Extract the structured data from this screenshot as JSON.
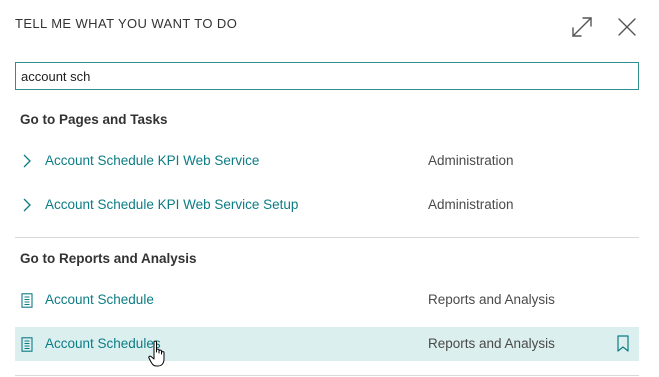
{
  "dialog": {
    "title": "TELL ME WHAT YOU WANT TO DO",
    "expand_icon": "expand-icon",
    "close_icon": "close-icon"
  },
  "search": {
    "value": "account sch",
    "placeholder": ""
  },
  "groups": [
    {
      "title": "Go to Pages and Tasks",
      "items": [
        {
          "label": "Account Schedule KPI Web Service",
          "category": "Administration",
          "icon": "chevron-right-icon"
        },
        {
          "label": "Account Schedule KPI Web Service Setup",
          "category": "Administration",
          "icon": "chevron-right-icon"
        }
      ]
    },
    {
      "title": "Go to Reports and Analysis",
      "items": [
        {
          "label": "Account Schedule",
          "category": "Reports and Analysis",
          "icon": "report-icon"
        },
        {
          "label": "Account Schedules",
          "category": "Reports and Analysis",
          "icon": "report-icon",
          "selected": true,
          "action_icon": "bookmark-icon"
        }
      ]
    }
  ],
  "colors": {
    "accent": "#0c7c84",
    "selected_row": "#dcefef",
    "search_border": "#2f8f8f"
  }
}
